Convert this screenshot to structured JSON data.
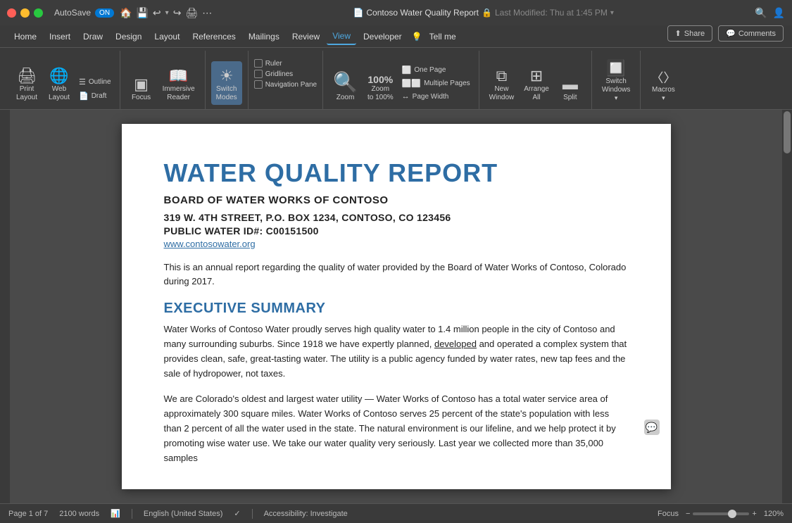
{
  "titlebar": {
    "autosave_label": "AutoSave",
    "autosave_state": "ON",
    "title": "Contoso Water Quality Report",
    "modified": "Last Modified: Thu at 1:45 PM",
    "icons": [
      "home",
      "save",
      "undo",
      "redo",
      "print",
      "custom"
    ]
  },
  "menubar": {
    "items": [
      "Home",
      "Insert",
      "Draw",
      "Design",
      "Layout",
      "References",
      "Mailings",
      "Review",
      "View",
      "Developer",
      "Tell me"
    ]
  },
  "ribbon": {
    "groups": [
      {
        "name": "views",
        "buttons": [
          {
            "id": "print-layout",
            "label": "Print\nLayout",
            "icon": "🖨"
          },
          {
            "id": "web-layout",
            "label": "Web\nLayout",
            "icon": "🌐"
          }
        ],
        "side_items": [
          "Outline",
          "Draft"
        ]
      },
      {
        "name": "immersive",
        "buttons": [
          {
            "id": "focus",
            "label": "Focus",
            "icon": "▣"
          },
          {
            "id": "immersive-reader",
            "label": "Immersive\nReader",
            "icon": "📖"
          }
        ]
      },
      {
        "name": "page-movement",
        "buttons": [
          {
            "id": "switch-modes",
            "label": "Switch\nModes",
            "icon": "☀"
          }
        ]
      },
      {
        "name": "show",
        "checks": [
          "Ruler",
          "Gridlines",
          "Navigation Pane"
        ]
      },
      {
        "name": "zoom",
        "buttons": [
          {
            "id": "zoom",
            "label": "Zoom",
            "icon": "🔍"
          },
          {
            "id": "zoom-100",
            "label": "Zoom\nto 100%",
            "icon": "100"
          }
        ],
        "page_views": [
          "One Page",
          "Multiple Pages",
          "Page Width"
        ]
      },
      {
        "name": "window",
        "buttons": [
          {
            "id": "new-window",
            "label": "New\nWindow",
            "icon": "⧉"
          },
          {
            "id": "arrange-all",
            "label": "Arrange\nAll",
            "icon": "⊞"
          },
          {
            "id": "split",
            "label": "Split",
            "icon": "⬛"
          }
        ]
      },
      {
        "name": "switch-windows",
        "buttons": [
          {
            "id": "switch-windows",
            "label": "Switch\nWindows",
            "icon": "🔲"
          }
        ]
      },
      {
        "name": "macros",
        "buttons": [
          {
            "id": "macros",
            "label": "Macros",
            "icon": "⟨⟩"
          }
        ]
      }
    ],
    "share_label": "Share",
    "comments_label": "Comments"
  },
  "document": {
    "title": "WATER QUALITY REPORT",
    "subtitle": "BOARD OF WATER WORKS OF CONTOSO",
    "address1": "319 W. 4TH STREET, P.O. BOX 1234, CONTOSO, CO 123456",
    "address2": "PUBLIC WATER ID#: C00151500",
    "website": "www.contosowater.org",
    "intro": "This is an annual report regarding the quality of water provided by the Board of Water Works of Contoso, Colorado during 2017.",
    "section1_title": "EXECUTIVE SUMMARY",
    "section1_body1": "Water Works of Contoso Water proudly serves high quality water to 1.4 million people in the city of Contoso and many surrounding suburbs. Since 1918 we have expertly planned, developed and operated a complex system that provides clean, safe, great-tasting water. The utility is a public agency funded by water rates, new tap fees and the sale of hydropower, not taxes.",
    "section1_body2": "We are Colorado's oldest and largest water utility — Water Works of Contoso has a total water service area of approximately 300 square miles. Water Works of Contoso serves 25 percent of the state's population with less than 2 percent of all the water used in the state. The natural environment is our lifeline, and we help protect it by promoting wise water use. We take our water quality very seriously. Last year we collected more than 35,000 samples"
  },
  "statusbar": {
    "page": "Page 1 of 7",
    "words": "2100 words",
    "language": "English (United States)",
    "accessibility": "Accessibility: Investigate",
    "focus": "Focus",
    "zoom": "120%",
    "zoom_minus": "−",
    "zoom_plus": "+"
  }
}
